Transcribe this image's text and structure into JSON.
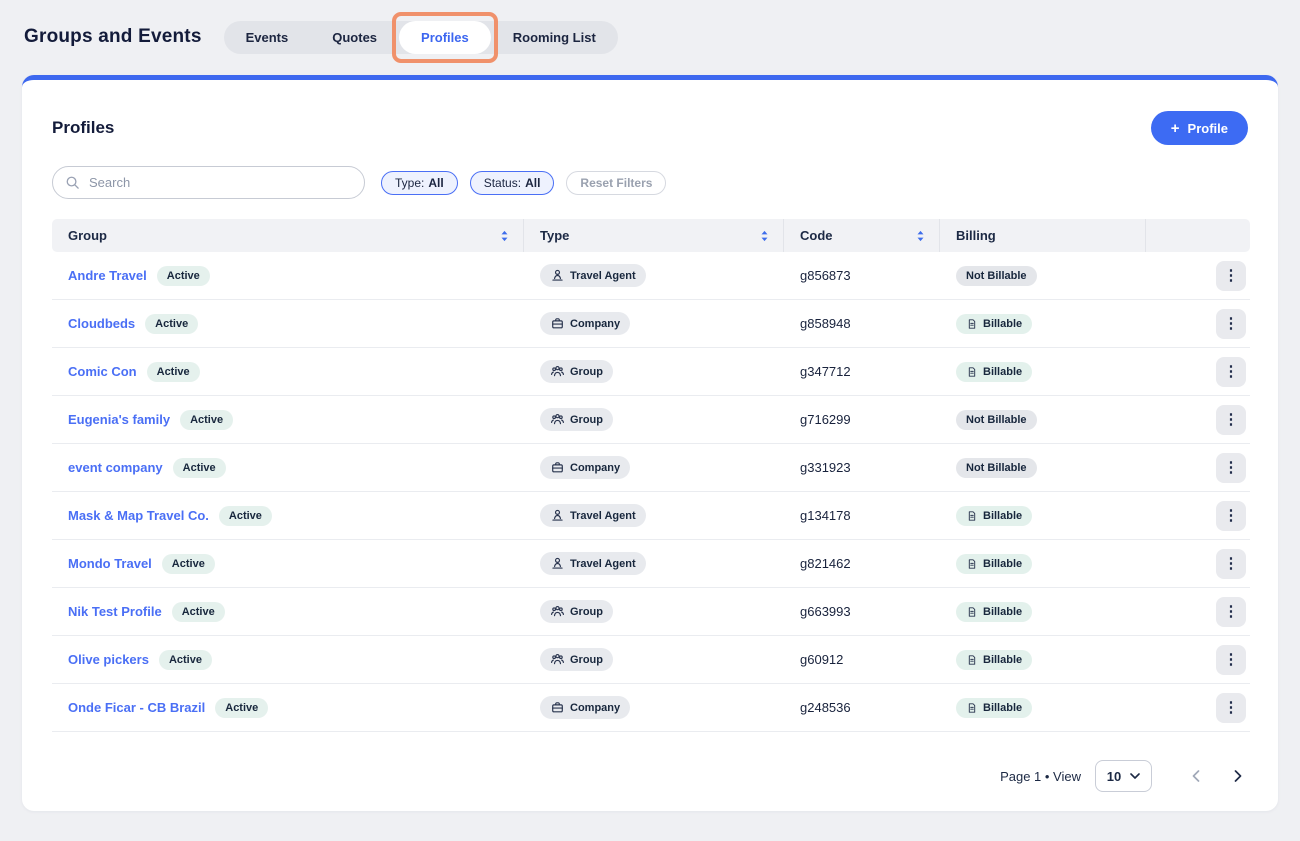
{
  "page": {
    "title": "Groups and Events"
  },
  "tabs": [
    {
      "label": "Events",
      "active": false,
      "annotated": false
    },
    {
      "label": "Quotes",
      "active": false,
      "annotated": false
    },
    {
      "label": "Profiles",
      "active": true,
      "annotated": true
    },
    {
      "label": "Rooming List",
      "active": false,
      "annotated": false
    }
  ],
  "panel": {
    "title": "Profiles",
    "add_button_label": "Profile",
    "add_button_icon": "plus-icon"
  },
  "search": {
    "placeholder": "Search",
    "icon": "search-icon"
  },
  "filters": {
    "type": {
      "label": "Type:",
      "value": "All"
    },
    "status": {
      "label": "Status:",
      "value": "All"
    },
    "reset_label": "Reset Filters"
  },
  "table": {
    "columns": [
      {
        "label": "Group",
        "sortable": true
      },
      {
        "label": "Type",
        "sortable": true
      },
      {
        "label": "Code",
        "sortable": true
      },
      {
        "label": "Billing",
        "sortable": false
      },
      {
        "label": "",
        "sortable": false
      }
    ],
    "rows": [
      {
        "group": "Andre Travel",
        "status": "Active",
        "type": "Travel Agent",
        "type_icon": "travel-agent-icon",
        "code": "g856873",
        "billing": "Not Billable",
        "billable": false
      },
      {
        "group": "Cloudbeds",
        "status": "Active",
        "type": "Company",
        "type_icon": "company-icon",
        "code": "g858948",
        "billing": "Billable",
        "billable": true
      },
      {
        "group": "Comic Con",
        "status": "Active",
        "type": "Group",
        "type_icon": "group-icon",
        "code": "g347712",
        "billing": "Billable",
        "billable": true
      },
      {
        "group": "Eugenia's family",
        "status": "Active",
        "type": "Group",
        "type_icon": "group-icon",
        "code": "g716299",
        "billing": "Not Billable",
        "billable": false
      },
      {
        "group": "event company",
        "status": "Active",
        "type": "Company",
        "type_icon": "company-icon",
        "code": "g331923",
        "billing": "Not Billable",
        "billable": false
      },
      {
        "group": "Mask & Map Travel Co.",
        "status": "Active",
        "type": "Travel Agent",
        "type_icon": "travel-agent-icon",
        "code": "g134178",
        "billing": "Billable",
        "billable": true
      },
      {
        "group": "Mondo Travel",
        "status": "Active",
        "type": "Travel Agent",
        "type_icon": "travel-agent-icon",
        "code": "g821462",
        "billing": "Billable",
        "billable": true
      },
      {
        "group": "Nik Test Profile",
        "status": "Active",
        "type": "Group",
        "type_icon": "group-icon",
        "code": "g663993",
        "billing": "Billable",
        "billable": true
      },
      {
        "group": "Olive pickers",
        "status": "Active",
        "type": "Group",
        "type_icon": "group-icon",
        "code": "g60912",
        "billing": "Billable",
        "billable": true
      },
      {
        "group": "Onde Ficar - CB Brazil",
        "status": "Active",
        "type": "Company",
        "type_icon": "company-icon",
        "code": "g248536",
        "billing": "Billable",
        "billable": true
      }
    ],
    "billing_icon": "invoice-icon",
    "row_action_icon": "kebab-icon",
    "sort_icon": "sort-arrows-icon"
  },
  "pagination": {
    "label": "Page 1 • View",
    "page_size": "10",
    "prev_enabled": false,
    "next_enabled": true
  },
  "colors": {
    "accent_blue": "#3D68EF",
    "link_blue": "#4A6FF5",
    "annotation_orange": "#F0916B",
    "badge_mint": "#E5F1ED",
    "badge_gray": "#E8EAEE",
    "header_bg": "#F1F2F5",
    "page_bg": "#EFF0F3"
  }
}
